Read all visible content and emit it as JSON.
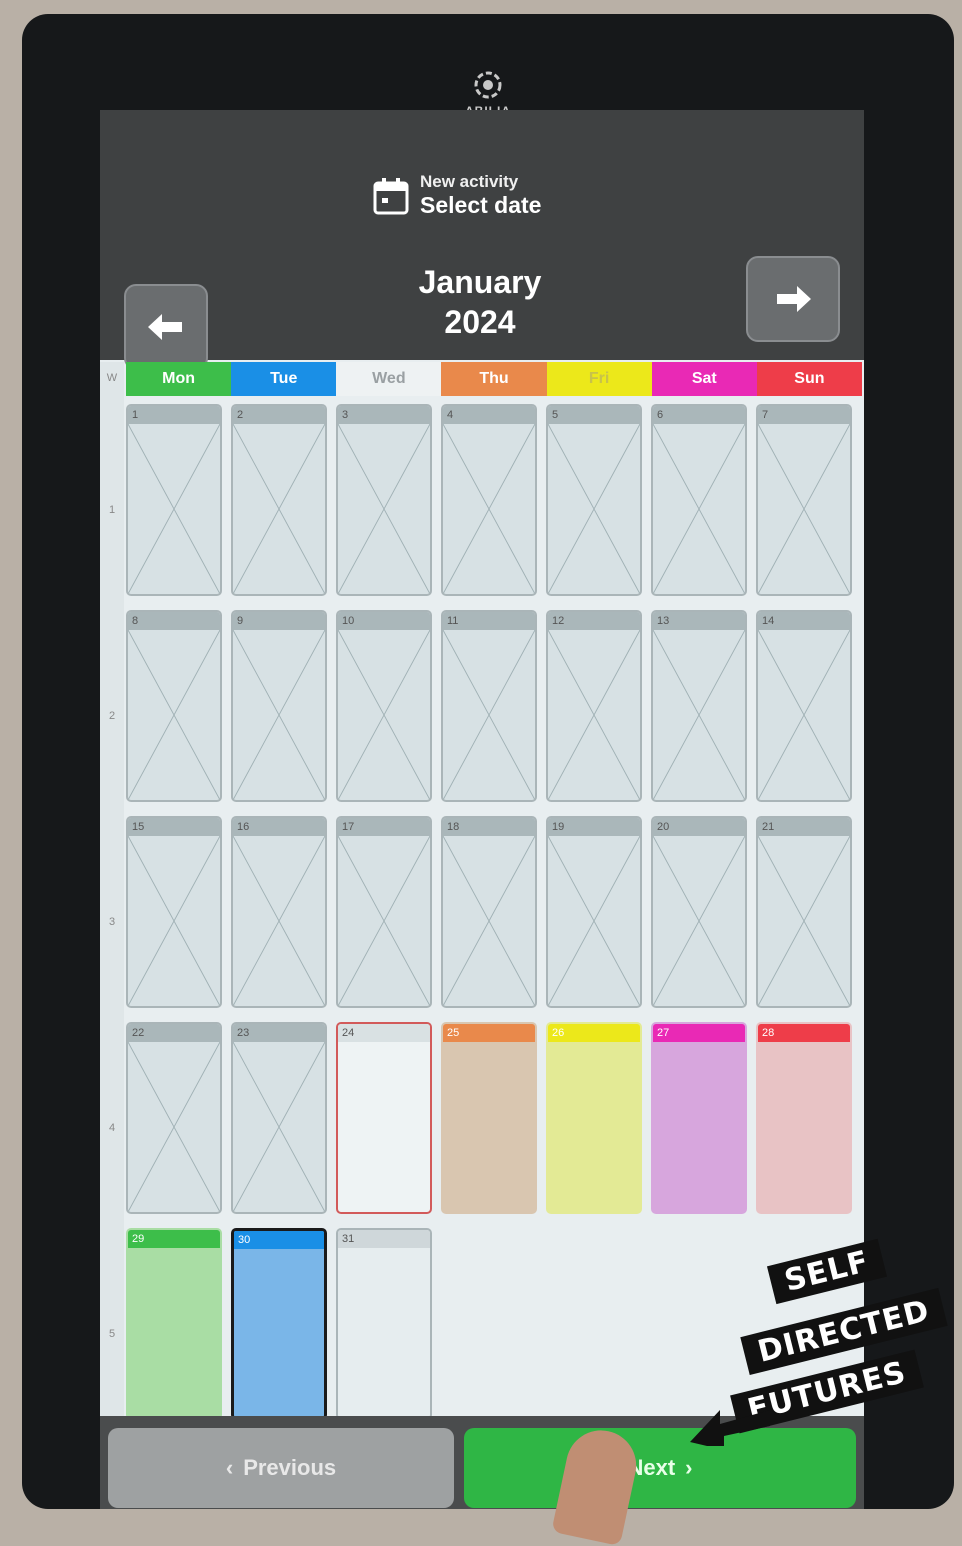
{
  "device": {
    "brand": "ABILIA"
  },
  "header": {
    "subtitle": "New activity",
    "title": "Select date",
    "month": "January",
    "year": "2024"
  },
  "nav": {
    "prev_icon": "arrow-left-icon",
    "next_icon": "arrow-right-icon"
  },
  "weekdays": [
    {
      "label": "Mon",
      "color": "#3dbe4a",
      "text_color": "#ffffff"
    },
    {
      "label": "Tue",
      "color": "#1a8fe6",
      "text_color": "#ffffff"
    },
    {
      "label": "Wed",
      "color": "#eef2f3",
      "text_color": "#9aa0a3"
    },
    {
      "label": "Thu",
      "color": "#e9894b",
      "text_color": "#ffffff"
    },
    {
      "label": "Fri",
      "color": "#ece81a",
      "text_color": "#c8c24a"
    },
    {
      "label": "Sat",
      "color": "#e929b5",
      "text_color": "#ffffff"
    },
    {
      "label": "Sun",
      "color": "#ee3d49",
      "text_color": "#ffffff"
    }
  ],
  "week_numbers": [
    "W",
    "1",
    "2",
    "3",
    "4",
    "5"
  ],
  "days": [
    "1",
    "2",
    "3",
    "4",
    "5",
    "6",
    "7",
    "8",
    "9",
    "10",
    "11",
    "12",
    "13",
    "14",
    "15",
    "16",
    "17",
    "18",
    "19",
    "20",
    "21",
    "22",
    "23",
    "24",
    "25",
    "26",
    "27",
    "28",
    "29",
    "30",
    "31"
  ],
  "today": "24",
  "selected": "30",
  "footer": {
    "previous_label": "Previous",
    "next_label": "Next"
  },
  "watermark": {
    "line1": "SELF",
    "line2": "DIRECTED",
    "line3": "FUTURES"
  }
}
